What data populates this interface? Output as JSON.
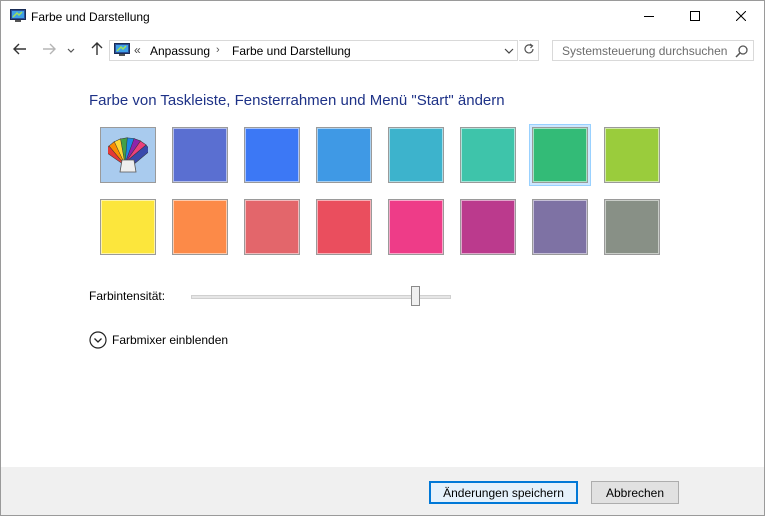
{
  "window": {
    "title": "Farbe und Darstellung"
  },
  "icons": {
    "app": "control-panel-icon",
    "back": "back-arrow-icon",
    "forward": "forward-arrow-icon",
    "recent": "chevron-down-icon",
    "up": "up-arrow-icon",
    "refresh": "refresh-icon",
    "search": "search-icon",
    "mixer": "chevron-down-circle-icon",
    "automatic": "color-palette-icon"
  },
  "address": {
    "overflow": "«",
    "breadcrumbs": [
      "Anpassung",
      "Farbe und Darstellung"
    ],
    "separator": "›"
  },
  "search": {
    "placeholder": "Systemsteuerung durchsuchen"
  },
  "main": {
    "heading": "Farbe von Taskleiste, Fensterrahmen und Menü \"Start\" ändern",
    "swatches_row1": [
      "automatic",
      "#5a6fd1",
      "#3c78f5",
      "#3f99e5",
      "#3db3cc",
      "#3ec4aa",
      "#33bb77",
      "#9acc3c"
    ],
    "swatches_row2": [
      "#fce63c",
      "#fc8a48",
      "#e3666b",
      "#ea4e5e",
      "#ee3c88",
      "#bb3a8d",
      "#7e72a4",
      "#889086"
    ],
    "selected_swatch": "#33bb77",
    "intensity_label": "Farbintensität:",
    "intensity_value": 0.86,
    "mixer_label": "Farbmixer einblenden"
  },
  "footer": {
    "save_label": "Änderungen speichern",
    "cancel_label": "Abbrechen"
  },
  "colors": {
    "heading": "#1e3287",
    "accent": "#0078d7",
    "selection": "#cce8ff"
  }
}
